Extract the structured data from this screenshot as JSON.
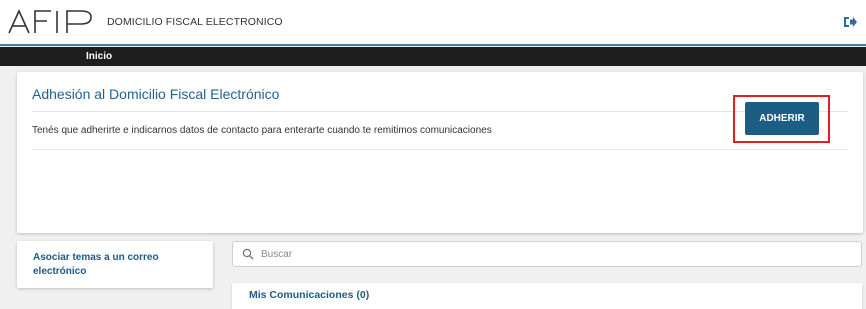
{
  "header": {
    "logo_text": "AFIP",
    "app_title": "DOMICILIO FISCAL ELECTRONICO",
    "logout_icon": "logout-icon"
  },
  "nav": {
    "items": [
      {
        "label": "Inicio"
      }
    ]
  },
  "adhesion_card": {
    "title": "Adhesión al Domicilio Fiscal Electrónico",
    "description": "Tenés que adherirte e indicarnos datos de contacto para enterarte cuando te remitimos comunicaciones",
    "button_label": "ADHERIR"
  },
  "sidebar": {
    "link_label": "Asociar temas a un correo electrónico"
  },
  "search": {
    "placeholder": "Buscar",
    "icon": "search-icon"
  },
  "tabs": [
    {
      "label": "Mis Comunicaciones (0)"
    }
  ],
  "colors": {
    "brand_blue": "#1c5d83",
    "title_blue": "#1f6391",
    "nav_bg": "#1e1e1e",
    "highlight": "#e02020"
  }
}
